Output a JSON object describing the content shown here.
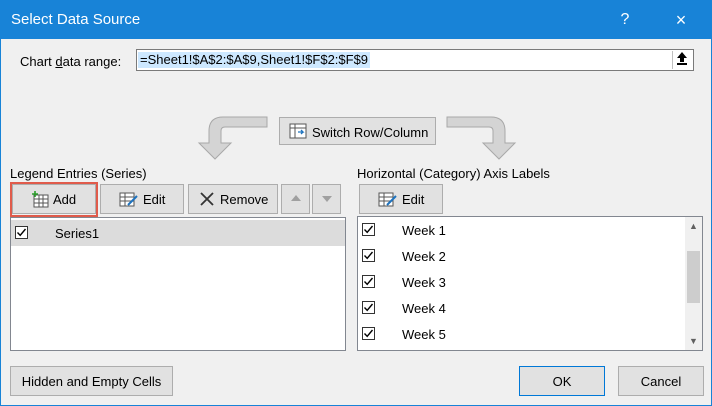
{
  "window": {
    "title": "Select Data Source",
    "help": "?",
    "close": "×"
  },
  "range": {
    "label": "Chart data range:",
    "value": "=Sheet1!$A$2:$A$9,Sheet1!$F$2:$F$9"
  },
  "switch_label": "Switch Row/Column",
  "legend": {
    "label": "Legend Entries (Series)",
    "add": "Add",
    "edit": "Edit",
    "remove": "Remove",
    "series": [
      {
        "name": "Series1",
        "checked": true
      }
    ]
  },
  "axis": {
    "label": "Horizontal (Category) Axis Labels",
    "edit": "Edit",
    "items": [
      {
        "name": "Week 1",
        "checked": true
      },
      {
        "name": "Week 2",
        "checked": true
      },
      {
        "name": "Week 3",
        "checked": true
      },
      {
        "name": "Week 4",
        "checked": true
      },
      {
        "name": "Week 5",
        "checked": true
      }
    ]
  },
  "footer": {
    "hidden_cells": "Hidden and Empty Cells",
    "ok": "OK",
    "cancel": "Cancel"
  },
  "colors": {
    "titlebar": "#1883d7",
    "highlight": "#cde8ff",
    "add_outline": "#e05b4b"
  }
}
